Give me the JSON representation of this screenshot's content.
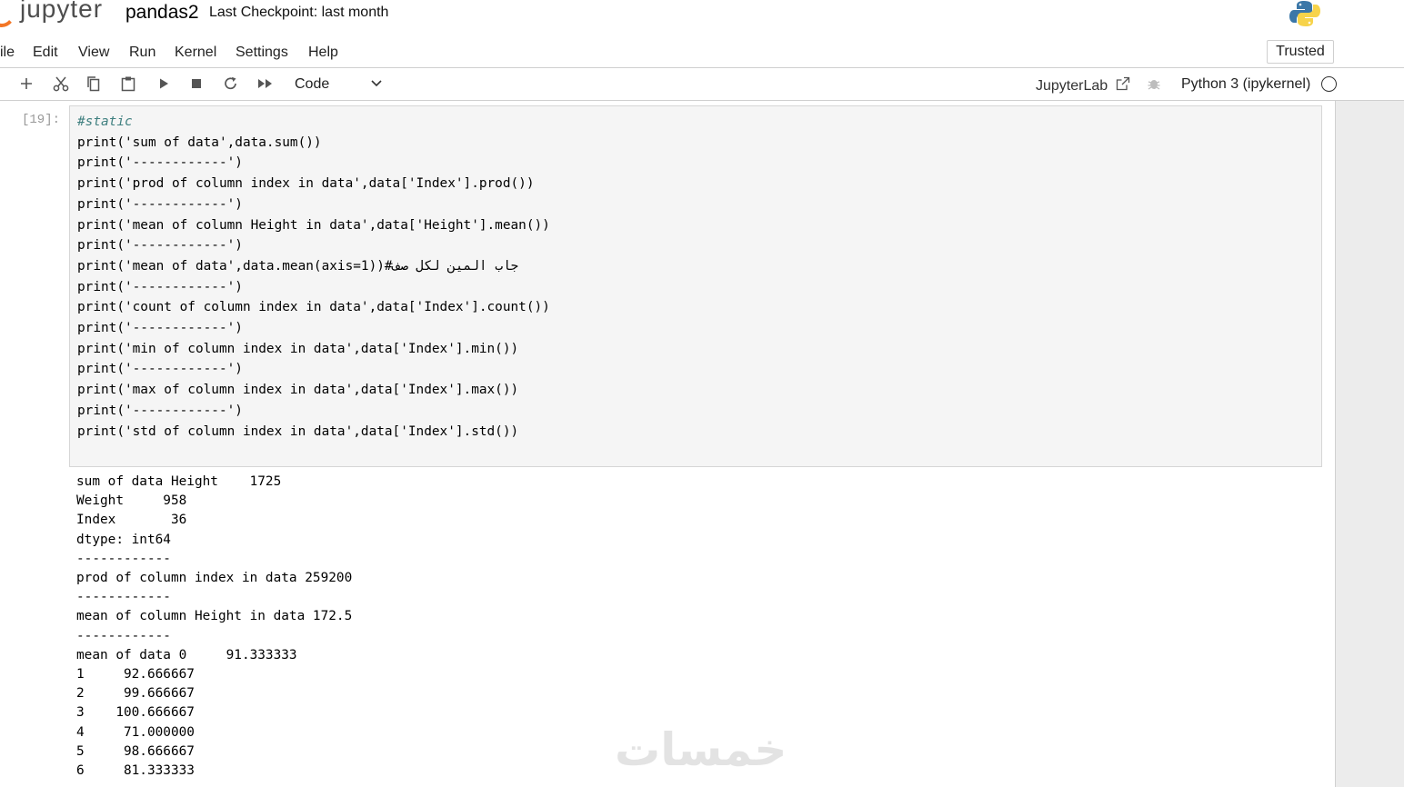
{
  "header": {
    "logo_text": "jupyter",
    "notebook_name": "pandas2",
    "checkpoint": "Last Checkpoint: last month",
    "kernel_logo_icon": "python-logo-icon"
  },
  "menu": {
    "items": [
      "ile",
      "Edit",
      "View",
      "Run",
      "Kernel",
      "Settings",
      "Help"
    ],
    "trusted_label": "Trusted"
  },
  "toolbar": {
    "icons": [
      "plus-icon",
      "cut-icon",
      "copy-icon",
      "paste-icon",
      "run-icon",
      "stop-icon",
      "restart-icon",
      "fast-forward-icon"
    ],
    "cell_type": "Code",
    "jupyterlab_label": "JupyterLab",
    "kernel_name": "Python 3 (ipykernel)"
  },
  "cell": {
    "prompt": "[19]:",
    "code_lines": [
      "#static",
      "print('sum of data',data.sum())",
      "print('------------')",
      "print('prod of column index in data',data['Index'].prod())",
      "print('------------')",
      "print('mean of column Height in data',data['Height'].mean())",
      "print('------------')",
      "print('mean of data',data.mean(axis=1))#جاب المين لكل صف",
      "print('------------')",
      "print('count of column index in data',data['Index'].count())",
      "print('------------')",
      "print('min of column index in data',data['Index'].min())",
      "print('------------')",
      "print('max of column index in data',data['Index'].max())",
      "print('------------')",
      "print('std of column index in data',data['Index'].std())"
    ],
    "output_lines": [
      "sum of data Height    1725",
      "Weight     958",
      "Index       36",
      "dtype: int64",
      "------------",
      "prod of column index in data 259200",
      "------------",
      "mean of column Height in data 172.5",
      "------------",
      "mean of data 0     91.333333",
      "1     92.666667",
      "2     99.666667",
      "3    100.666667",
      "4     71.000000",
      "5     98.666667",
      "6     81.333333"
    ]
  },
  "watermark": "خمسات"
}
